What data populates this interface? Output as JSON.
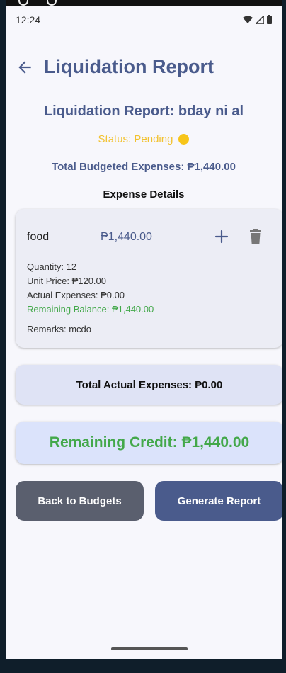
{
  "status_bar": {
    "time": "12:24"
  },
  "appbar": {
    "title": "Liquidation Report"
  },
  "report": {
    "title": "Liquidation Report: bday ni al",
    "status": "Status: Pending",
    "total_budgeted": "Total Budgeted Expenses: ₱1,440.00"
  },
  "expense_details": {
    "heading": "Expense Details",
    "item": {
      "name": "food",
      "amount": "₱1,440.00",
      "quantity": "Quantity: 12",
      "unit_price": "Unit Price: ₱120.00",
      "actual_expenses": "Actual Expenses: ₱0.00",
      "remaining_balance": "Remaining Balance: ₱1,440.00",
      "remarks": "Remarks: mcdo"
    }
  },
  "totals": {
    "total_actual": "Total Actual Expenses: ₱0.00",
    "remaining_credit": "Remaining Credit: ₱1,440.00"
  },
  "buttons": {
    "back": "Back to Budgets",
    "generate": "Generate Report"
  },
  "colors": {
    "primary": "#4a5b8c",
    "pending": "#f7c51a",
    "positive": "#43a84a",
    "back_button": "#5a5f6e"
  },
  "icons": [
    "back-arrow-icon",
    "plus-icon",
    "trash-icon",
    "wifi-icon",
    "signal-icon",
    "battery-icon",
    "status-dot-icon"
  ]
}
